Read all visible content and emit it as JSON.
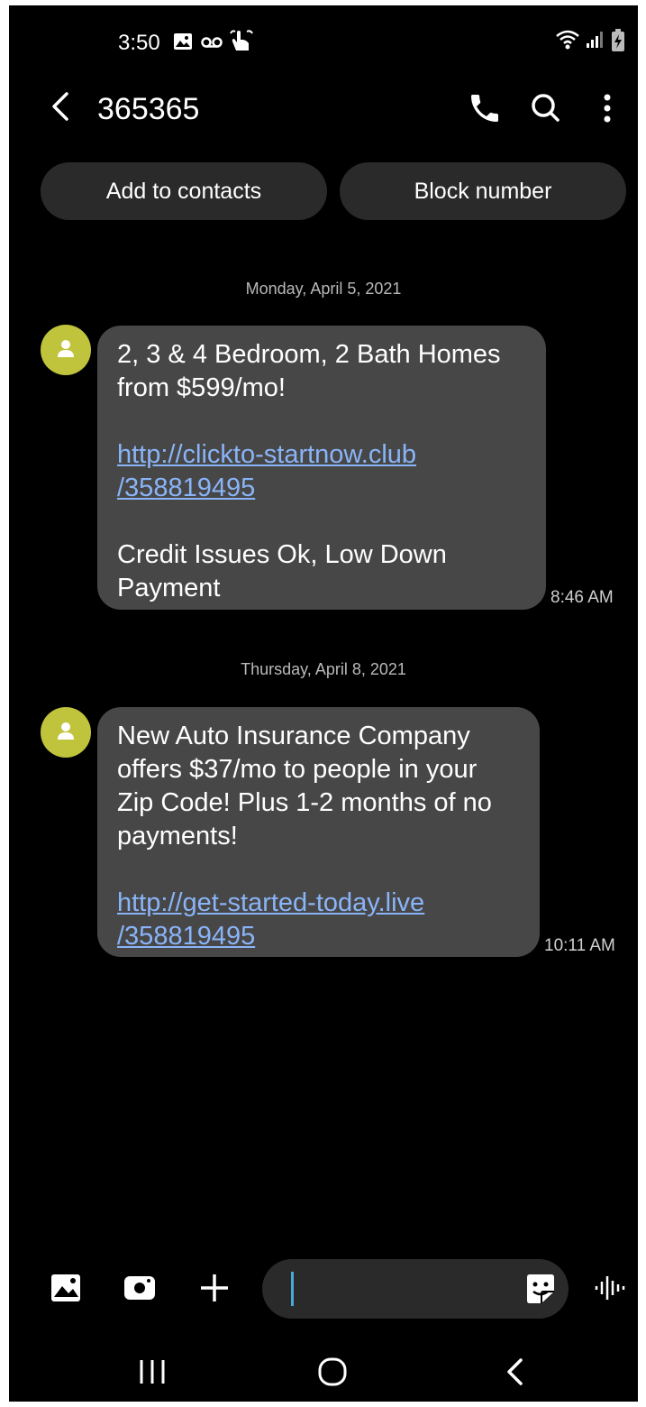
{
  "status_bar": {
    "time": "3:50",
    "icons": [
      "gallery-notification-icon",
      "voicemail-icon",
      "touch-icon",
      "wifi-icon",
      "signal-icon",
      "battery-icon"
    ]
  },
  "header": {
    "title": "365365",
    "icons": [
      "back-arrow-icon",
      "phone-icon",
      "search-icon",
      "more-options-icon"
    ]
  },
  "actions": {
    "add_contact": "Add to contacts",
    "block": "Block number"
  },
  "conversation": {
    "date_1": "Monday, April 5, 2021",
    "message_1": {
      "line_1": "2, 3 & 4 Bedroom, 2 Bath Homes",
      "line_2": "from $599/mo!",
      "link_1": "http://clickto-startnow.club",
      "link_2": "/358819495",
      "line_3": "Credit Issues Ok, Low Down",
      "line_4": "Payment",
      "time": "8:46 AM"
    },
    "date_2": "Thursday, April 8, 2021",
    "message_2": {
      "line_1": "New Auto Insurance Company",
      "line_2": "offers $37/mo to people in your",
      "line_3": "Zip Code! Plus 1-2 months of no",
      "line_4": "payments!",
      "link_1": "http://get-started-today.live",
      "link_2": "/358819495",
      "time": "10:11 AM"
    }
  },
  "composer": {
    "icons": [
      "gallery-icon",
      "camera-icon",
      "plus-icon",
      "sticker-icon",
      "voice-icon"
    ]
  },
  "nav_bar": {
    "icons": [
      "recents-icon",
      "home-icon",
      "back-icon"
    ]
  },
  "colors": {
    "background": "#000000",
    "bubble": "#474747",
    "pill": "#2a2a2a",
    "link": "#8ab4f8",
    "avatar": "#c0c43c"
  }
}
